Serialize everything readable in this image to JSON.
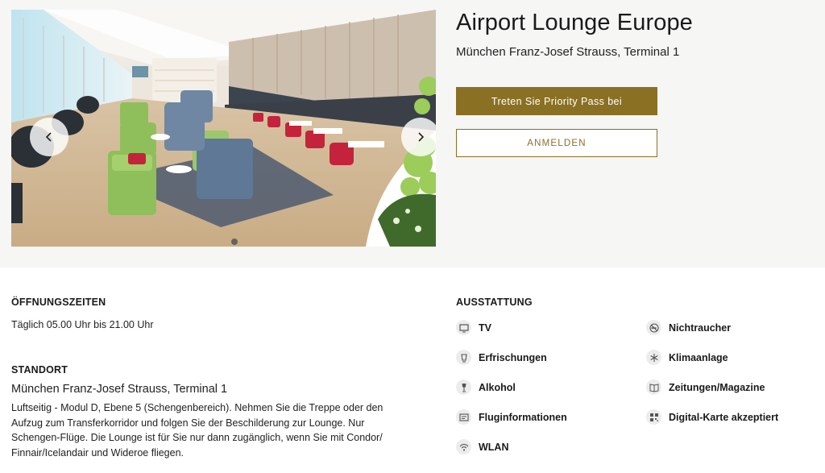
{
  "lounge": {
    "title": "Airport Lounge Europe",
    "subtitle": "München Franz-Josef Strauss, Terminal 1"
  },
  "actions": {
    "join_label": "Treten Sie Priority Pass bei",
    "login_label": "ANMELDEN"
  },
  "carousel": {
    "prev_icon": "chevron-left-icon",
    "next_icon": "chevron-right-icon",
    "slide_count_visible": 1
  },
  "opening": {
    "heading": "ÖFFNUNGSZEITEN",
    "text": "Täglich 05.00 Uhr bis 21.00 Uhr"
  },
  "location": {
    "heading": "STANDORT",
    "name": "München Franz-Josef Strauss, Terminal 1",
    "description": "Luftseitig - Modul D, Ebene 5 (Schengenbereich). Nehmen Sie die Treppe oder den Aufzug zum Transferkorridor und folgen Sie der Beschilderung zur Lounge. Nur Schengen-Flüge. Die Lounge ist für Sie nur dann zugänglich, wenn Sie mit Condor/ Finnair/Icelandair und Wideroe fliegen."
  },
  "amenities": {
    "heading": "AUSSTATTUNG",
    "items": [
      {
        "label": "TV",
        "icon": "tv-icon"
      },
      {
        "label": "Nichtraucher",
        "icon": "no-smoking-icon"
      },
      {
        "label": "Erfrischungen",
        "icon": "cup-icon"
      },
      {
        "label": "Klimaanlage",
        "icon": "snowflake-icon"
      },
      {
        "label": "Alkohol",
        "icon": "wine-glass-icon"
      },
      {
        "label": "Zeitungen/Magazine",
        "icon": "newspaper-icon"
      },
      {
        "label": "Fluginformationen",
        "icon": "flight-info-icon"
      },
      {
        "label": "Digital-Karte akzeptiert",
        "icon": "qr-code-icon"
      },
      {
        "label": "WLAN",
        "icon": "wifi-icon"
      }
    ]
  },
  "colors": {
    "accent": "#8a7023",
    "hero_background": "#f6f6f5"
  }
}
